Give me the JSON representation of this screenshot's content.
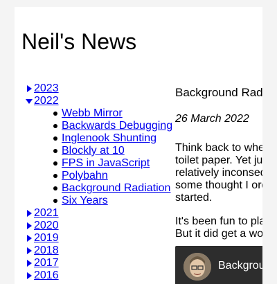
{
  "site": {
    "title": "Neil's News"
  },
  "sidebar": {
    "years_before": [
      {
        "label": "2023",
        "expanded": false
      }
    ],
    "expanded_year": {
      "label": "2022",
      "expanded": true
    },
    "posts": [
      "Webb Mirror",
      "Backwards Debugging",
      "Inglenook Shunting",
      "Blockly at 10",
      "FPS in JavaScript",
      "Polybahn",
      "Background Radiation",
      "Six Years"
    ],
    "years_after": [
      {
        "label": "2021",
        "expanded": false
      },
      {
        "label": "2020",
        "expanded": false
      },
      {
        "label": "2019",
        "expanded": false
      },
      {
        "label": "2018",
        "expanded": false
      },
      {
        "label": "2017",
        "expanded": false
      },
      {
        "label": "2016",
        "expanded": false
      }
    ]
  },
  "article": {
    "title": "Background Radiation",
    "date": "26 March 2022",
    "paragraph1_lines": [
      "Think back to when C",
      "toilet paper. Yet just a",
      "relatively inconseque",
      "some thought I order",
      "started."
    ],
    "paragraph2_lines": [
      "It's been fun to play w",
      "But it did get a worko"
    ],
    "video": {
      "title": "Background"
    }
  },
  "colors": {
    "link": "#0000ee",
    "toggle": "#0000ee",
    "page_background": "#f4f4f4",
    "content_background": "#ffffff",
    "video_background": "#2d2d2d"
  },
  "icons": {
    "collapsed_toggle": "triangle-right-icon",
    "expanded_toggle": "triangle-down-icon",
    "bullet": "disc-bullet-icon"
  }
}
